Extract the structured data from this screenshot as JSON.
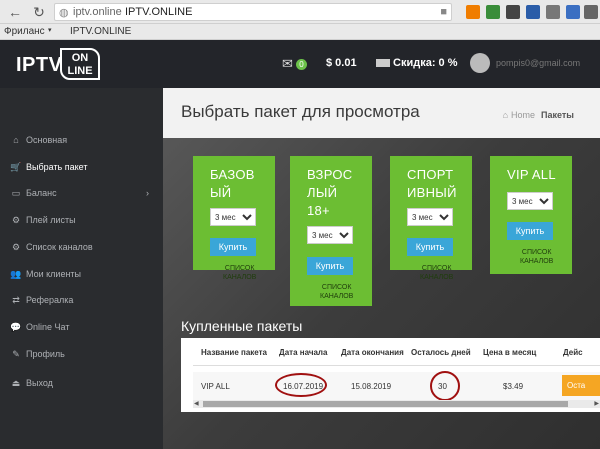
{
  "browser": {
    "url": "iptv.online",
    "page_title": "IPTV.ONLINE",
    "bookmarks": [
      "Фриланс",
      "IPTV.ONLINE"
    ]
  },
  "header": {
    "logo_main": "IPTV",
    "logo_on": "ON",
    "logo_line": "LINE",
    "mail_count": "0",
    "balance": "$ 0.01",
    "discount": "Скидка: 0 %",
    "user_name": "pompis0@gmail.com"
  },
  "sidebar": {
    "items": [
      {
        "label": "Основная",
        "icon": "home-icon",
        "glyph": "⌂"
      },
      {
        "label": "Выбрать пакет",
        "icon": "cart-icon",
        "glyph": "🛒"
      },
      {
        "label": "Баланс",
        "icon": "card-icon",
        "glyph": "▭",
        "arrow": "›"
      },
      {
        "label": "Плей листы",
        "icon": "gear-icon",
        "glyph": "⚙"
      },
      {
        "label": "Список каналов",
        "icon": "gear-icon",
        "glyph": "⚙"
      },
      {
        "label": "Мои клиенты",
        "icon": "users-icon",
        "glyph": "👥"
      },
      {
        "label": "Рефералка",
        "icon": "share-icon",
        "glyph": "⇄"
      },
      {
        "label": "Online Чат",
        "icon": "chat-icon",
        "glyph": "💬"
      },
      {
        "label": "Профиль",
        "icon": "edit-icon",
        "glyph": "✎"
      },
      {
        "label": "Выход",
        "icon": "logout-icon",
        "glyph": "⏏"
      }
    ]
  },
  "main": {
    "title": "Выбрать пакет для просмотра",
    "breadcrumb": {
      "home": "Home",
      "current": "Пакеты"
    },
    "packages": [
      {
        "name_lines": [
          "БАЗОВ",
          "ЫЙ"
        ],
        "select": "3 мес",
        "buy": "Купить",
        "channels_lines": [
          "СПИСОК",
          "КАНАЛОВ"
        ]
      },
      {
        "name_lines": [
          "ВЗРОС",
          "ЛЫЙ",
          "18+"
        ],
        "select": "3 мес",
        "buy": "Купить",
        "channels_lines": [
          "СПИСОК",
          "КАНАЛОВ"
        ]
      },
      {
        "name_lines": [
          "СПОРТ",
          "ИВНЫЙ"
        ],
        "select": "3 мес",
        "buy": "Купить",
        "channels_lines": [
          "СПИСОК",
          "КАНАЛОВ"
        ]
      },
      {
        "name_lines": [
          "VIP ALL"
        ],
        "select": "3 мес",
        "buy": "Купить",
        "channels_lines": [
          "СПИСОК",
          "КАНАЛОВ"
        ]
      }
    ],
    "purchased_title": "Купленные пакеты",
    "table": {
      "headers": [
        "Название пакета",
        "Дата начала",
        "Дата окончания",
        "Осталось дней",
        "Цена в месяц",
        "Дейс"
      ],
      "row": {
        "name": "VIP ALL",
        "start": "16.07.2019",
        "end": "15.08.2019",
        "days_left": "30",
        "price": "$3.49",
        "status": "Оста"
      }
    }
  },
  "colors": {
    "accent_green": "#6cbe33",
    "buy_blue": "#3aa6d8",
    "status_orange": "#f5a623",
    "annotation_red": "#a01010"
  }
}
